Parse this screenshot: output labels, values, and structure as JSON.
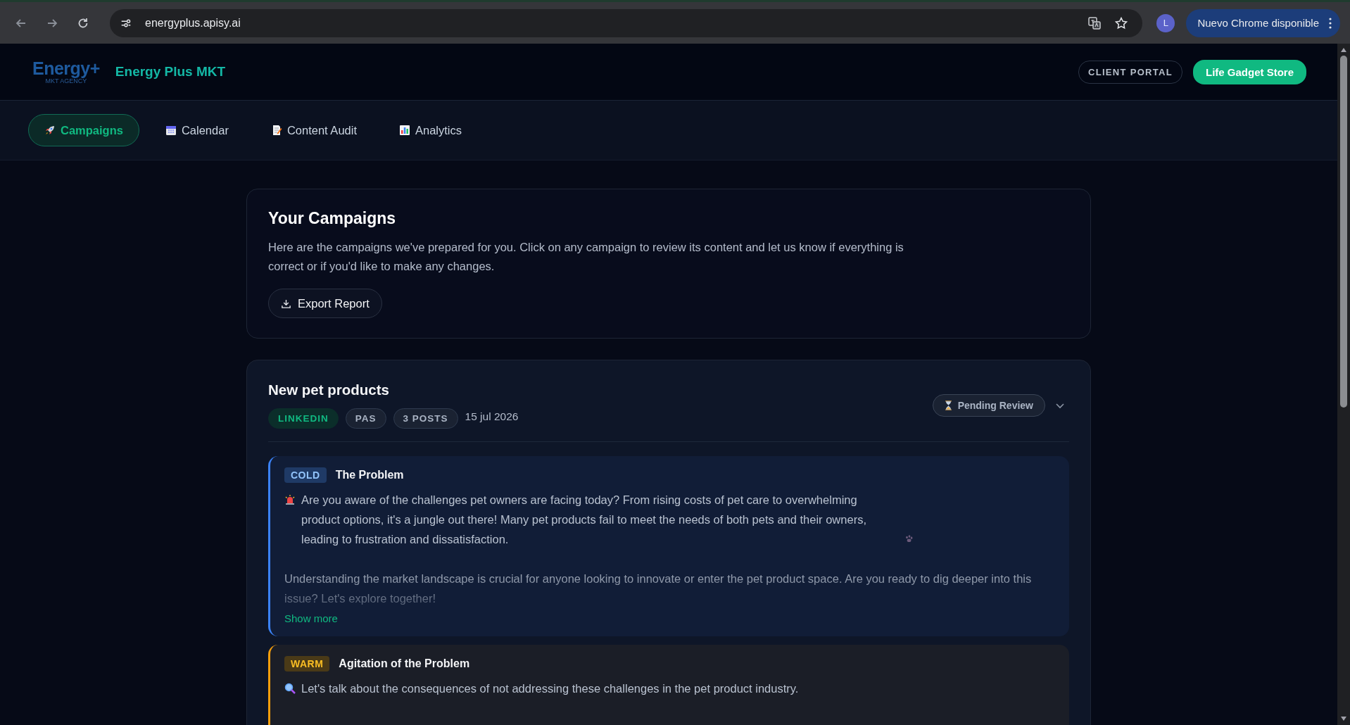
{
  "browser": {
    "url": "energyplus.apisy.ai",
    "avatar": "L",
    "update_button": "Nuevo Chrome disponible"
  },
  "header": {
    "logo": "Energy+",
    "logo_sub": "MKT AGENCY",
    "brand": "Energy Plus MKT",
    "portal_badge": "CLIENT PORTAL",
    "store_button": "Life Gadget Store"
  },
  "tabs": [
    {
      "label": "Campaigns",
      "selected": true
    },
    {
      "label": "Calendar",
      "selected": false
    },
    {
      "label": "Content Audit",
      "selected": false
    },
    {
      "label": "Analytics",
      "selected": false
    }
  ],
  "intro": {
    "title": "Your Campaigns",
    "text": "Here are the campaigns we've prepared for you. Click on any campaign to review its content and let us know if everything is correct or if you'd like to make any changes.",
    "export_button": "Export Report"
  },
  "campaign": {
    "title": "New pet products",
    "tags": [
      {
        "label": "LINKEDIN",
        "kind": "platform"
      },
      {
        "label": "PAS",
        "kind": "plain"
      },
      {
        "label": "3 POSTS",
        "kind": "plain"
      }
    ],
    "date": "15 jul 2026",
    "status": "Pending Review",
    "posts": [
      {
        "kind": "cold",
        "stage": "COLD",
        "title": "The Problem",
        "paragraphs": [
          "Are you aware of the challenges pet owners are facing today? From rising costs of pet care to overwhelming product options, it's a jungle out there! Many pet products fail to meet the needs of both pets and their owners, leading to frustration and dissatisfaction.",
          "Understanding the market landscape is crucial for anyone looking to innovate or enter the pet product space. Are you ready to dig deeper into this issue? Let's explore together!"
        ],
        "show_more": "Show more"
      },
      {
        "kind": "warm",
        "stage": "WARM",
        "title": "Agitation of the Problem",
        "paragraphs": [
          "Let's talk about the consequences of not addressing these challenges in the pet product industry."
        ]
      }
    ]
  }
}
